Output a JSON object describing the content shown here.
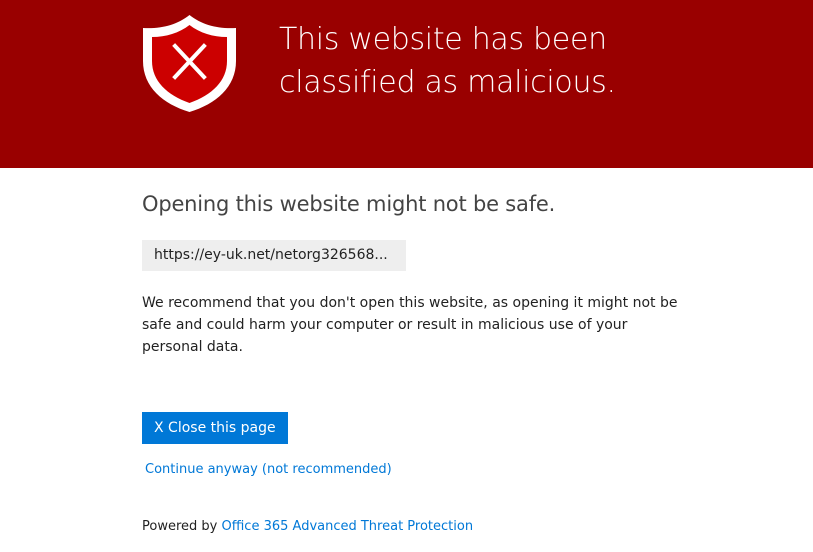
{
  "banner": {
    "title_line1": "This website has been",
    "title_line2": "classified as malicious.",
    "icon": "shield-x-icon",
    "background_color": "#990000"
  },
  "main": {
    "subtitle": "Opening this website might not be safe.",
    "url": "https://ey-uk.net/netorg326568...",
    "warning": "We recommend that you don't open this website, as opening it might not be safe and could harm your computer or result in malicious use of your personal data.",
    "close_button_label": "X Close this page",
    "continue_link_label": "Continue anyway (not recommended)"
  },
  "footer": {
    "powered_by": "Powered by",
    "product_link": "Office 365 Advanced Threat Protection"
  },
  "colors": {
    "accent": "#0078d7",
    "danger": "#990000"
  }
}
